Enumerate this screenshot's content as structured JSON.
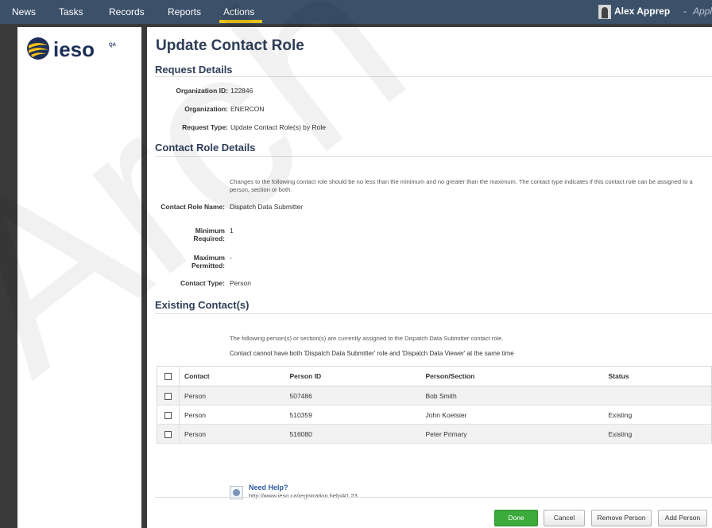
{
  "nav": {
    "items": [
      {
        "label": "News"
      },
      {
        "label": "Tasks"
      },
      {
        "label": "Records"
      },
      {
        "label": "Reports"
      },
      {
        "label": "Actions"
      }
    ],
    "active": "Actions",
    "active_color": "#e6c21a",
    "background": "#3b5069"
  },
  "user": {
    "name": "Alex Apprep",
    "separator": "-",
    "app_label": "Appl"
  },
  "logo": {
    "text": "ieso",
    "env_badge": "QA"
  },
  "page": {
    "title": "Update Contact Role",
    "watermark_text": "Arch"
  },
  "request_details": {
    "heading": "Request Details",
    "fields": [
      {
        "label": "Organization ID:",
        "value": "122846"
      },
      {
        "label": "Organization:",
        "value": "ENERCON"
      },
      {
        "label": "Request Type:",
        "value": "Update Contact Role(s) by Role"
      }
    ]
  },
  "contact_role_details": {
    "heading": "Contact Role Details",
    "note": "Changes to the following contact role should be no less than the minimum and no greater than the maximum. The contact type indicates if this contact role can be assigned to a person, section or both.",
    "fields": [
      {
        "label": "Contact Role Name:",
        "value": "Dispatch Data Submitter"
      },
      {
        "label": "Minimum Required:",
        "value": "1"
      },
      {
        "label": "Maximum Permitted:",
        "value": "-"
      },
      {
        "label": "Contact Type:",
        "value": "Person"
      }
    ]
  },
  "existing_contacts": {
    "heading": "Existing Contact(s)",
    "note": "The following person(s) or section(s) are currently assigned to the Dispatch Data Submitter contact role.",
    "warning": "Contact cannot have both 'Dispatch Data Submitter' role and 'Dispatch Data Viewer' at the same time",
    "columns": [
      "Contact",
      "Person ID",
      "Person/Section",
      "Status"
    ],
    "rows": [
      {
        "contact": "Person",
        "person_id": "507486",
        "person_section": "Bob Smith",
        "status": ""
      },
      {
        "contact": "Person",
        "person_id": "510359",
        "person_section": "John Koetsier",
        "status": "Existing"
      },
      {
        "contact": "Person",
        "person_id": "516080",
        "person_section": "Peter Primary",
        "status": "Existing"
      }
    ]
  },
  "help": {
    "title": "Need Help?",
    "url": "http://www.ieso.ca/registration.help/#1.23"
  },
  "buttons": {
    "done": "Done",
    "cancel": "Cancel",
    "remove_person": "Remove Person",
    "add_person": "Add Person"
  }
}
